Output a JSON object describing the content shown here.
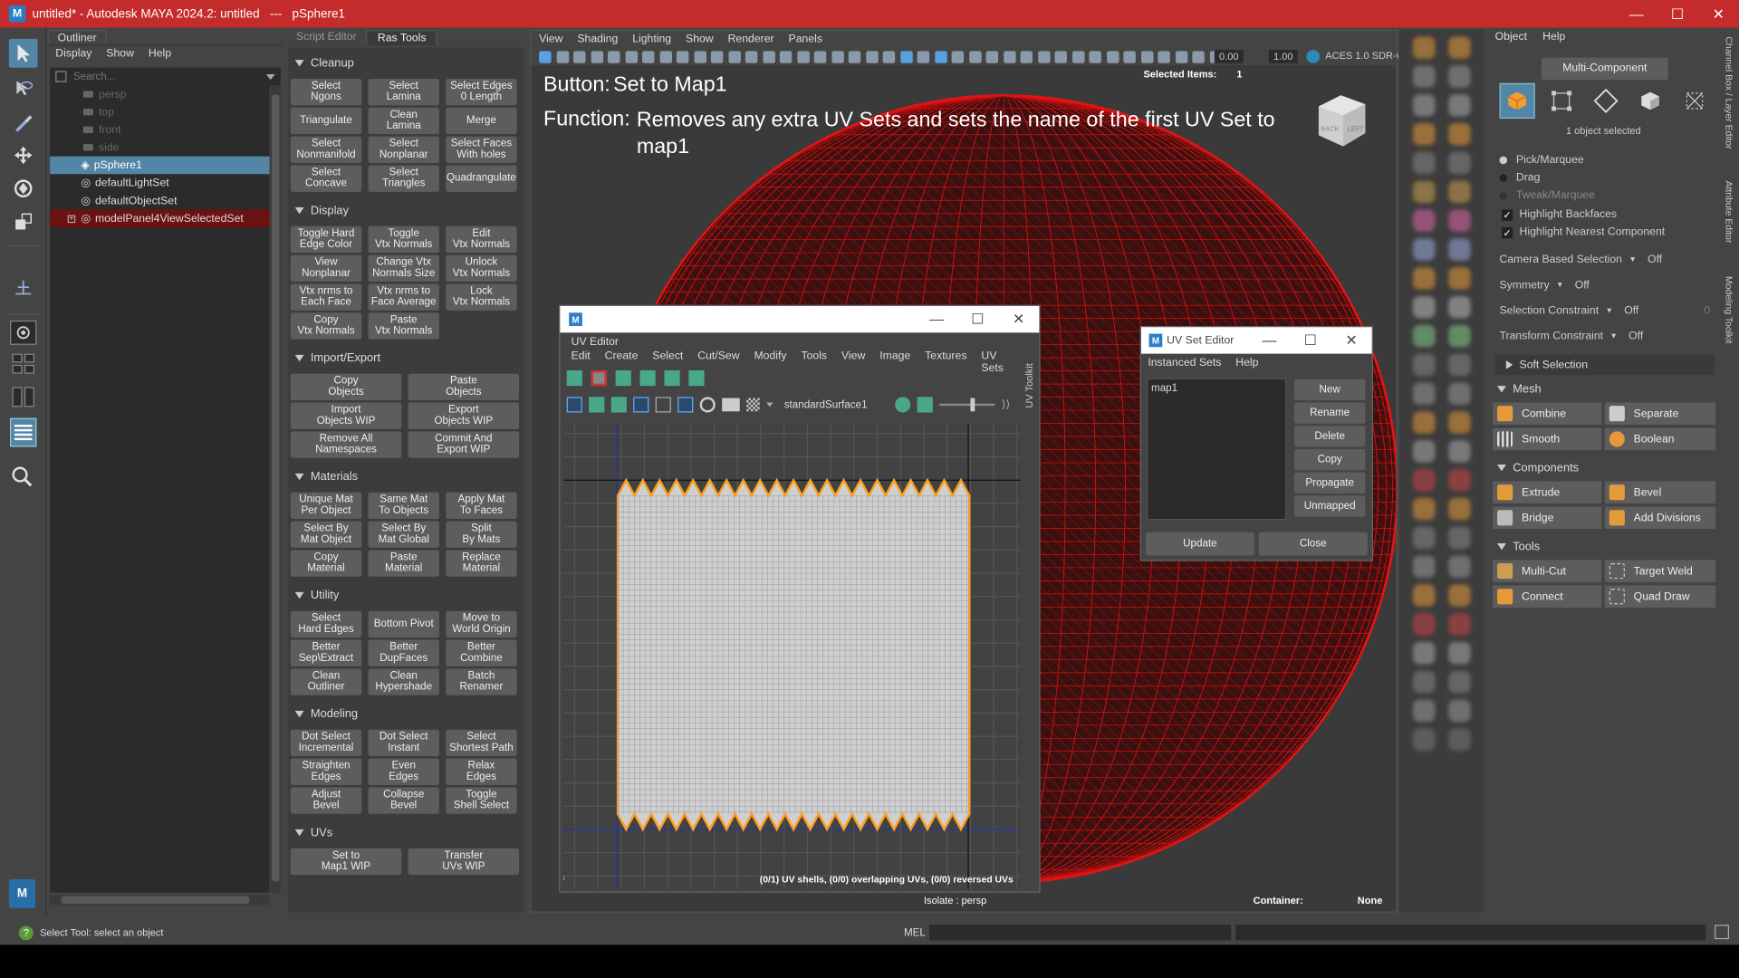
{
  "titlebar": {
    "title": "untitled* - Autodesk MAYA 2024.2: untitled   ---   pSphere1",
    "logo": "M"
  },
  "outliner": {
    "tab": "Outliner",
    "menu": [
      "Display",
      "Show",
      "Help"
    ],
    "search_placeholder": "Search...",
    "items": [
      {
        "label": "persp",
        "dim": true
      },
      {
        "label": "top",
        "dim": true
      },
      {
        "label": "front",
        "dim": true
      },
      {
        "label": "side",
        "dim": true
      },
      {
        "label": "pSphere1",
        "selected": true
      },
      {
        "label": "defaultLightSet"
      },
      {
        "label": "defaultObjectSet"
      },
      {
        "label": "modelPanel4ViewSelectedSet",
        "red": true
      }
    ]
  },
  "ras": {
    "tabs": [
      "Script Editor",
      "Ras Tools"
    ],
    "sections": {
      "cleanup": {
        "title": "Cleanup",
        "buttons": [
          "Select\nNgons",
          "Select\nLamina",
          "Select Edges\n0 Length",
          "Triangulate",
          "Clean\nLamina",
          "Merge",
          "Select\nNonmanifold",
          "Select\nNonplanar",
          "Select Faces\nWith holes",
          "Select\nConcave",
          "Select\nTriangles",
          "Quadrangulate"
        ]
      },
      "display": {
        "title": "Display",
        "buttons": [
          "Toggle Hard\nEdge Color",
          "Toggle\nVtx Normals",
          "Edit\nVtx Normals",
          "View\nNonplanar",
          "Change Vtx\nNormals Size",
          "Unlock\nVtx Normals",
          "Vtx nrms to\nEach Face",
          "Vtx nrms to\nFace Average",
          "Lock\nVtx Normals",
          "Copy\nVtx Normals",
          "Paste\nVtx Normals"
        ]
      },
      "importexport": {
        "title": "Import/Export",
        "buttons": [
          "Copy\nObjects",
          "Paste\nObjects",
          "Import\nObjects WIP",
          "Export\nObjects WIP",
          "Remove All\nNamespaces",
          "Commit And\nExport WIP"
        ]
      },
      "materials": {
        "title": "Materials",
        "buttons": [
          "Unique Mat\nPer Object",
          "Same Mat\nTo Objects",
          "Apply Mat\nTo Faces",
          "Select By\nMat Object",
          "Select By\nMat Global",
          "Split\nBy Mats",
          "Copy\nMaterial",
          "Paste\nMaterial",
          "Replace\nMaterial"
        ]
      },
      "utility": {
        "title": "Utility",
        "buttons": [
          "Select\nHard Edges",
          "Bottom Pivot",
          "Move to\nWorld Origin",
          "Better\nSep\\Extract",
          "Better\nDupFaces",
          "Better\nCombine",
          "Clean\nOutliner",
          "Clean\nHypershade",
          "Batch\nRenamer"
        ]
      },
      "modeling": {
        "title": "Modeling",
        "buttons": [
          "Dot Select\nIncremental",
          "Dot Select\nInstant",
          "Select\nShortest Path",
          "Straighten\nEdges",
          "Even\nEdges",
          "Relax\nEdges",
          "Adjust\nBevel",
          "Collapse\nBevel",
          "Toggle\nShell Select"
        ]
      },
      "uvs": {
        "title": "UVs",
        "buttons": [
          "Set to\nMap1 WIP",
          "Transfer\nUVs WIP"
        ]
      }
    }
  },
  "viewport": {
    "menu": [
      "View",
      "Shading",
      "Lighting",
      "Show",
      "Renderer",
      "Panels"
    ],
    "exposure": "0.00",
    "gamma": "1.00",
    "colorspace": "ACES 1.0 SDR-v",
    "selected_items_label": "Selected Items:",
    "selected_items_value": "1",
    "overlay_button_label": "Button:",
    "overlay_button_value": "Set to Map1",
    "overlay_function_label": "Function:",
    "overlay_function_value": "Removes any extra UV Sets and sets the name of the first UV Set to map1",
    "isolate": "Isolate : persp",
    "container_label": "Container:",
    "container_value": "None",
    "cube_label_back": "BACK",
    "cube_label_left": "LEFT",
    "colors": {
      "sphere": "#cc0000",
      "background": "#3a3a3a"
    }
  },
  "uv_editor": {
    "title": "UV Editor",
    "logo": "M",
    "menu": [
      "Edit",
      "Create",
      "Select",
      "Cut/Sew",
      "Modify",
      "Tools",
      "View",
      "Image",
      "Textures",
      "UV Sets"
    ],
    "material": "standardSurface1",
    "side_tab": "UV Toolkit",
    "status": "(0/1) UV shells, (0/0) overlapping UVs, (0/0) reversed UVs"
  },
  "uv_set_editor": {
    "title": "UV Set Editor",
    "menu": [
      "Instanced Sets",
      "Help"
    ],
    "sets": [
      "map1"
    ],
    "buttons": [
      "New",
      "Rename",
      "Delete",
      "Copy",
      "Propagate",
      "Unmapped"
    ],
    "update": "Update",
    "close": "Close"
  },
  "modeling_toolkit": {
    "menu": [
      "Object",
      "Help"
    ],
    "mode": "Multi-Component",
    "selection_info": "1 object selected",
    "radios": [
      "Pick/Marquee",
      "Drag",
      "Tweak/Marquee"
    ],
    "checks": [
      "Highlight Backfaces",
      "Highlight Nearest Component"
    ],
    "options": [
      {
        "label": "Camera Based Selection",
        "value": "Off"
      },
      {
        "label": "Symmetry",
        "value": "Off"
      },
      {
        "label": "Selection Constraint",
        "value": "Off",
        "extra": "0"
      },
      {
        "label": "Transform Constraint",
        "value": "Off"
      }
    ],
    "soft_selection": "Soft Selection",
    "mesh_title": "Mesh",
    "mesh": [
      "Combine",
      "Separate",
      "Smooth",
      "Boolean"
    ],
    "components_title": "Components",
    "components": [
      "Extrude",
      "Bevel",
      "Bridge",
      "Add Divisions"
    ],
    "tools_title": "Tools",
    "tools": [
      "Multi-Cut",
      "Target Weld",
      "Connect",
      "Quad Draw"
    ],
    "side_tabs": [
      "Channel Box / Layer Editor",
      "Attribute Editor",
      "Modeling Toolkit"
    ]
  },
  "status_bar": {
    "help": "Select Tool: select an object",
    "mel": "MEL"
  }
}
